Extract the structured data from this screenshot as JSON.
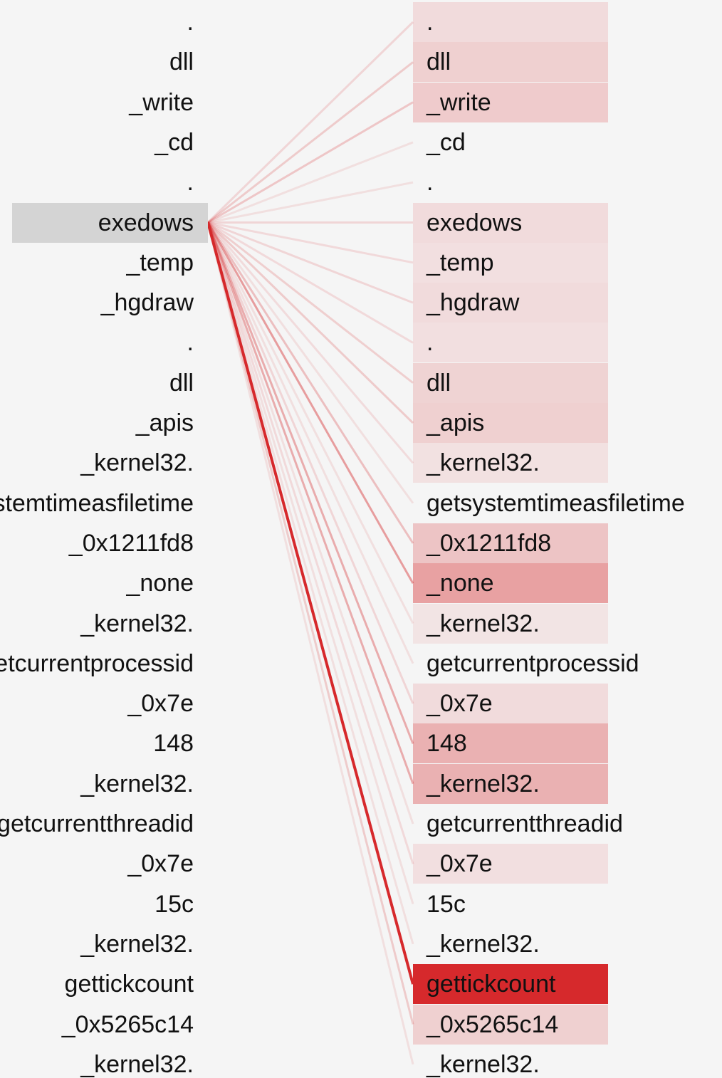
{
  "diagram": {
    "selected_source_index": 5,
    "accent_color": "#d6292c",
    "selected_bg_color": "#d4d4d4",
    "source_tokens": [
      ".",
      "dll",
      "_write",
      "_cd",
      ".",
      "exedows",
      "_temp",
      "_hgdraw",
      ".",
      "dll",
      "_apis",
      "_kernel32.",
      "getsystemtimeasfiletime",
      "_0x1211fd8",
      "_none",
      "_kernel32.",
      "getcurrentprocessid",
      "_0x7e",
      "148",
      "_kernel32.",
      "getcurrentthreadid",
      "_0x7e",
      "15c",
      "_kernel32.",
      "gettickcount",
      "_0x5265c14",
      "_kernel32."
    ],
    "target_tokens": [
      {
        "text": ".",
        "weight": 0.08
      },
      {
        "text": "dll",
        "weight": 0.14
      },
      {
        "text": "_write",
        "weight": 0.16
      },
      {
        "text": "_cd",
        "weight": 0
      },
      {
        "text": ".",
        "weight": 0
      },
      {
        "text": "exedows",
        "weight": 0.08
      },
      {
        "text": "_temp",
        "weight": 0.06
      },
      {
        "text": "_hgdraw",
        "weight": 0.08
      },
      {
        "text": ".",
        "weight": 0.06
      },
      {
        "text": "dll",
        "weight": 0.12
      },
      {
        "text": "_apis",
        "weight": 0.14
      },
      {
        "text": "_kernel32.",
        "weight": 0.05
      },
      {
        "text": "getsystemtimeasfiletime",
        "weight": 0
      },
      {
        "text": "_0x1211fd8",
        "weight": 0.2
      },
      {
        "text": "_none",
        "weight": 0.38
      },
      {
        "text": "_kernel32.",
        "weight": 0.03
      },
      {
        "text": "getcurrentprocessid",
        "weight": 0
      },
      {
        "text": "_0x7e",
        "weight": 0.08
      },
      {
        "text": "148",
        "weight": 0.3
      },
      {
        "text": "_kernel32.",
        "weight": 0.3
      },
      {
        "text": "getcurrentthreadid",
        "weight": 0
      },
      {
        "text": "_0x7e",
        "weight": 0.06
      },
      {
        "text": "15c",
        "weight": 0
      },
      {
        "text": "_kernel32.",
        "weight": 0
      },
      {
        "text": "gettickcount",
        "weight": 1.0
      },
      {
        "text": "_0x5265c14",
        "weight": 0.14
      },
      {
        "text": "_kernel32.",
        "weight": 0
      }
    ]
  }
}
